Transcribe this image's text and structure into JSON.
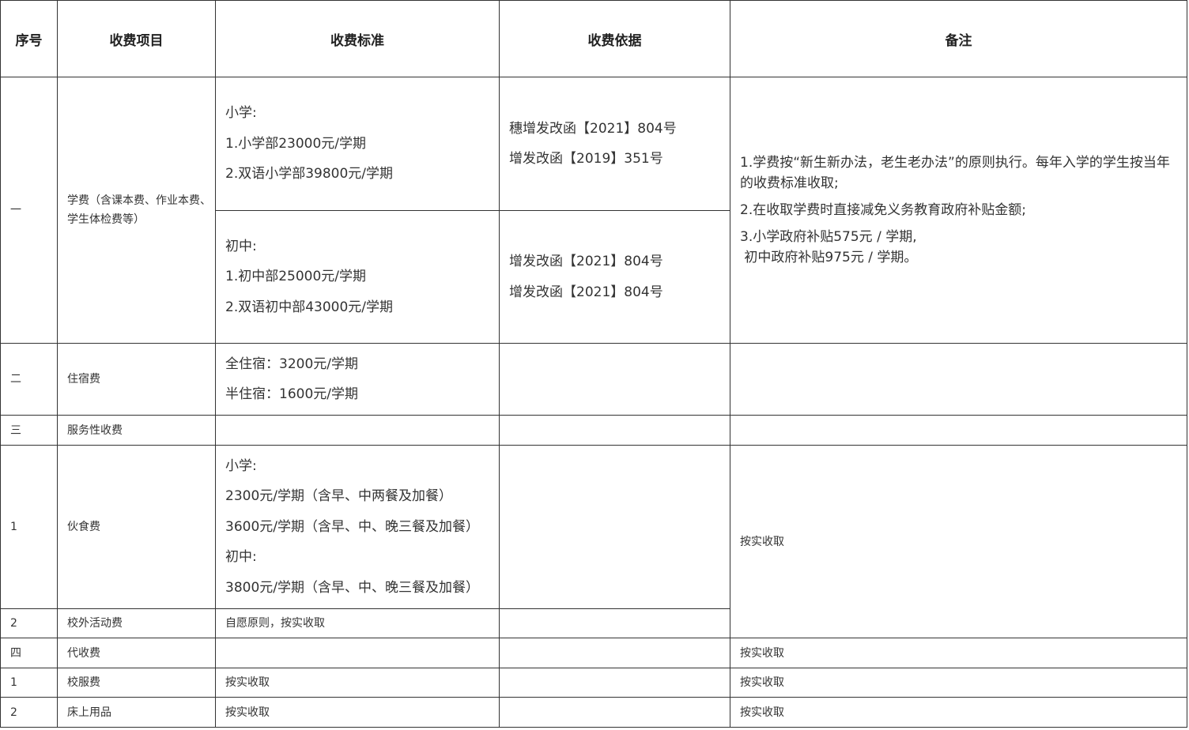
{
  "headers": {
    "seq": "序号",
    "item": "收费项目",
    "standard": "收费标准",
    "basis": "收费依据",
    "remark": "备注"
  },
  "rows": {
    "r1": {
      "seq": "一",
      "item": "学费（含课本费、作业本费、学生体检费等）",
      "primary_standard": [
        "小学:",
        "1.小学部23000元/学期",
        "2.双语小学部39800元/学期"
      ],
      "primary_basis": [
        "穗增发改函【2021】804号",
        "增发改函【2019】351号"
      ],
      "middle_standard": [
        "初中:",
        "1.初中部25000元/学期",
        "2.双语初中部43000元/学期"
      ],
      "middle_basis": [
        "增发改函【2021】804号",
        "增发改函【2021】804号"
      ],
      "remark": [
        "1.学费按“新生新办法，老生老办法”的原则执行。每年入学的学生按当年的收费标准收取;",
        "2.在收取学费时直接减免义务教育政府补贴金额;",
        "3.小学政府补贴575元 / 学期,\n 初中政府补贴975元 / 学期。"
      ]
    },
    "r2": {
      "seq": "二",
      "item": "住宿费",
      "standard": [
        "全住宿：3200元/学期",
        "半住宿：1600元/学期"
      ]
    },
    "r3": {
      "seq": "三",
      "item": "服务性收费"
    },
    "r3_1": {
      "seq": "1",
      "item": "伙食费",
      "standard": [
        "小学:",
        "2300元/学期（含早、中两餐及加餐）",
        "3600元/学期（含早、中、晚三餐及加餐）",
        "初中:",
        "3800元/学期（含早、中、晚三餐及加餐）"
      ],
      "remark": "按实收取"
    },
    "r3_2": {
      "seq": "2",
      "item": "校外活动费",
      "standard": "自愿原则，按实收取"
    },
    "r4": {
      "seq": "四",
      "item": "代收费",
      "remark": "按实收取"
    },
    "r4_1": {
      "seq": "1",
      "item": "校服费",
      "standard": "按实收取",
      "remark": "按实收取"
    },
    "r4_2": {
      "seq": "2",
      "item": "床上用品",
      "standard": "按实收取",
      "remark": "按实收取"
    }
  }
}
